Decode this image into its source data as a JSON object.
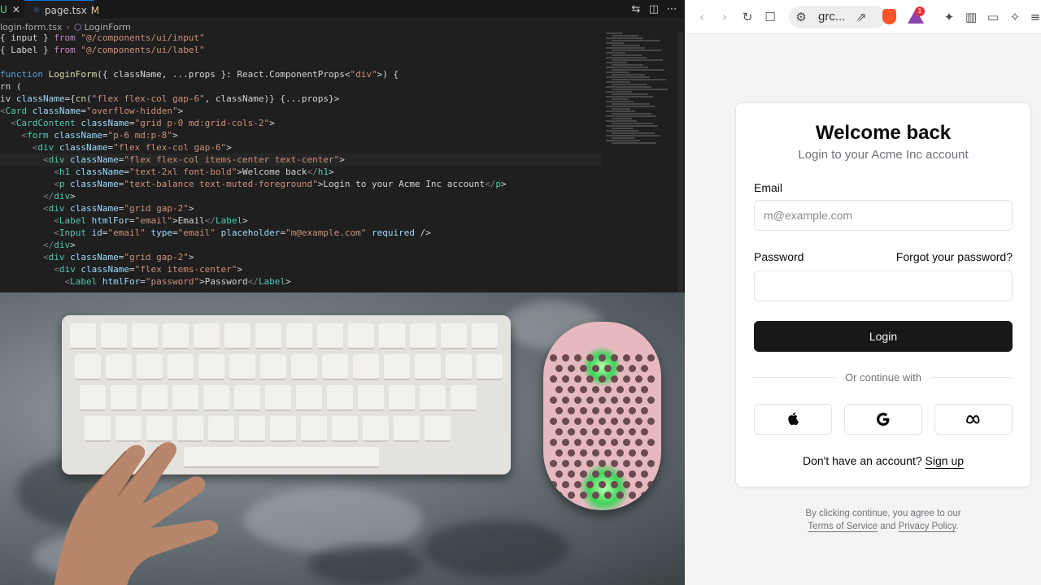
{
  "editor": {
    "tabs": {
      "prev_marker": "U",
      "prev_close": "✕",
      "active_tab": "page.tsx",
      "active_modified": "M"
    },
    "breadcrumb": {
      "file": "login-form.tsx",
      "symbol": "LoginForm"
    },
    "code_lines": [
      "{ input } from \"@/components/ui/input\"",
      "{ Label } from \"@/components/ui/label\"",
      "",
      "function LoginForm({ className, ...props }: React.ComponentProps<\"div\">) {",
      "rn (",
      "iv className={cn(\"flex flex-col gap-6\", className)} {...props}>",
      "<Card className=\"overflow-hidden\">",
      "<CardContent className=\"grid p-0 md:grid-cols-2\">",
      "<form className=\"p-6 md:p-8\">",
      "<div className=\"flex flex-col gap-6\">",
      "<div className=\"flex flex-col items-center text-center\">",
      "<h1 className=\"text-2xl font-bold\">Welcome back</h1>",
      "<p className=\"text-balance text-muted-foreground\">Login to your Acme Inc account</p>",
      "</div>",
      "<div className=\"grid gap-2\">",
      "<Label htmlFor=\"email\">Email</Label>",
      "<Input id=\"email\" type=\"email\" placeholder=\"m@example.com\" required />",
      "</div>",
      "<div className=\"grid gap-2\">",
      "<div className=\"flex items-center\">",
      "<Label htmlFor=\"password\">Password</Label>"
    ]
  },
  "browser": {
    "url_text": "grc...",
    "rewards_badge": "1",
    "title": "Welcome back",
    "subtitle": "Login to your Acme Inc account",
    "email_label": "Email",
    "email_placeholder": "m@example.com",
    "email_value": "",
    "password_label": "Password",
    "password_value": "",
    "forgot_link": "Forgot your password?",
    "login_button": "Login",
    "divider_text": "Or continue with",
    "social_buttons": [
      "apple-icon",
      "google-icon",
      "meta-icon"
    ],
    "signup_prompt": "Don't have an account?",
    "signup_link": "Sign up",
    "terms_prefix": "By clicking continue, you agree to our",
    "terms_link": "Terms of Service",
    "terms_and": "and",
    "privacy_link": "Privacy Policy",
    "terms_suffix": "."
  },
  "colors": {
    "primary": "#18181b",
    "muted_text": "#71717a",
    "border": "#e4e4e7",
    "editor_bg": "#1f1f1f"
  }
}
